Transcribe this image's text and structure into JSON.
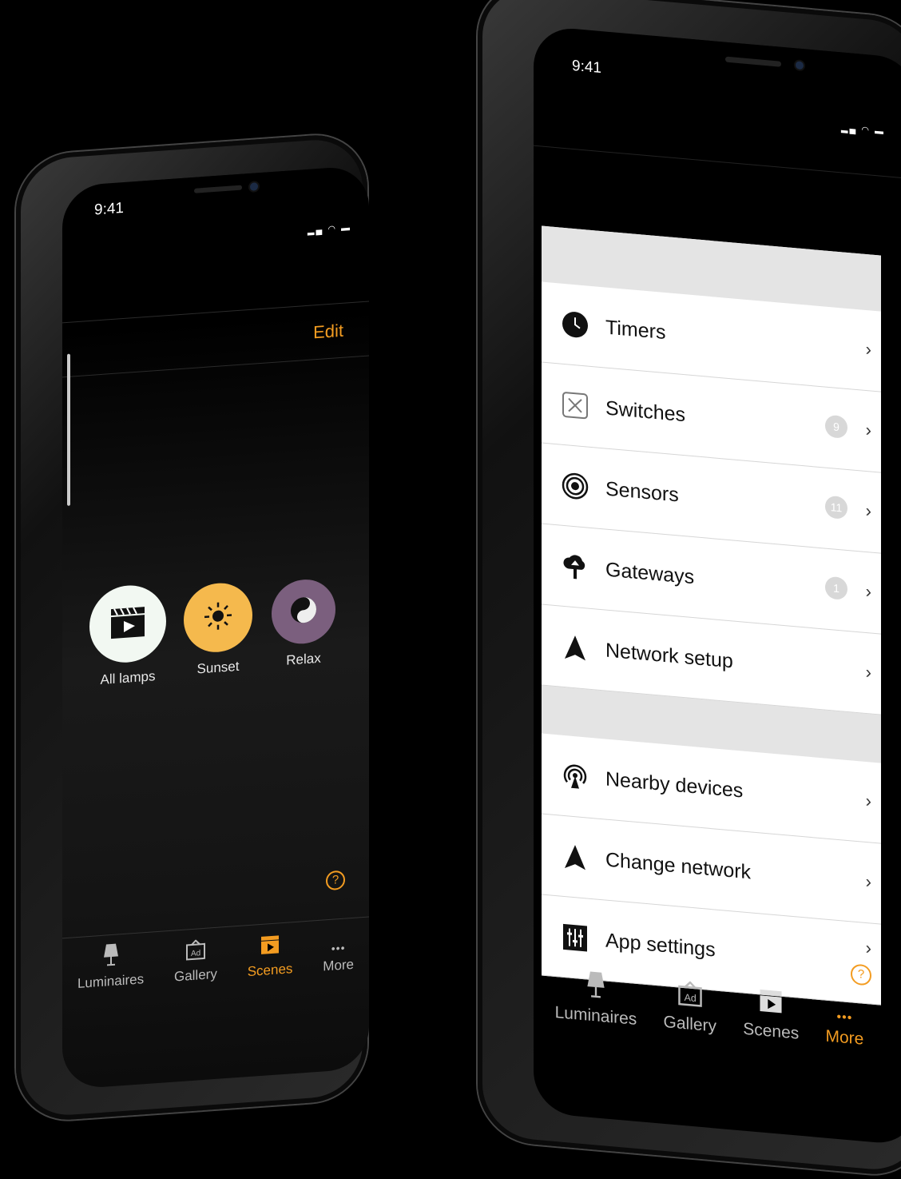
{
  "left_phone": {
    "time": "9:41",
    "edit_label": "Edit",
    "scenes": [
      {
        "label": "All lamps",
        "icon": "clapperboard-icon",
        "color": "#f2f8f2"
      },
      {
        "label": "Sunset",
        "icon": "sun-icon",
        "color": "#f5b94d"
      },
      {
        "label": "Relax",
        "icon": "yin-yang-icon",
        "color": "#7b5f7e"
      }
    ],
    "help_label": "?",
    "tabs": [
      {
        "label": "Luminaires",
        "icon": "lamp-icon",
        "active": false
      },
      {
        "label": "Gallery",
        "icon": "gallery-icon",
        "active": false
      },
      {
        "label": "Scenes",
        "icon": "scenes-icon",
        "active": true
      },
      {
        "label": "More",
        "icon": "more-icon",
        "active": false
      }
    ]
  },
  "right_phone": {
    "time": "9:41",
    "section1": [
      {
        "label": "Timers",
        "icon": "clock-icon",
        "badge": ""
      },
      {
        "label": "Switches",
        "icon": "switch-icon",
        "badge": "9"
      },
      {
        "label": "Sensors",
        "icon": "sensor-icon",
        "badge": "11"
      },
      {
        "label": "Gateways",
        "icon": "gateway-icon",
        "badge": "1"
      },
      {
        "label": "Network setup",
        "icon": "network-icon",
        "badge": ""
      }
    ],
    "section2": [
      {
        "label": "Nearby devices",
        "icon": "nearby-icon"
      },
      {
        "label": "Change network",
        "icon": "network-icon"
      },
      {
        "label": "App settings",
        "icon": "sliders-icon"
      }
    ],
    "help_label": "?",
    "tabs": [
      {
        "label": "Luminaires",
        "icon": "lamp-icon",
        "active": false
      },
      {
        "label": "Gallery",
        "icon": "gallery-icon",
        "active": false
      },
      {
        "label": "Scenes",
        "icon": "scenes-icon",
        "active": false
      },
      {
        "label": "More",
        "icon": "more-icon",
        "active": true
      }
    ]
  },
  "colors": {
    "accent": "#f39c21"
  }
}
